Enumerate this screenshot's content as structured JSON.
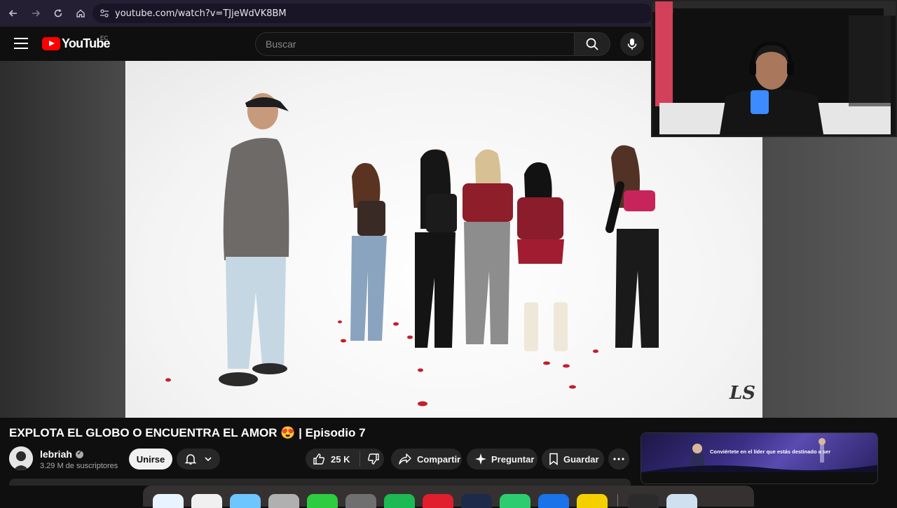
{
  "browser": {
    "url": "youtube.com/watch?v=TJjeWdVK8BM"
  },
  "header": {
    "logo_text": "YouTube",
    "country_code": "EC",
    "search_placeholder": "Buscar"
  },
  "video": {
    "title": "EXPLOTA EL GLOBO O ENCUENTRA EL AMOR 😍 | Episodio 7",
    "watermark": "LS"
  },
  "channel": {
    "name": "lebriah",
    "subscribers": "3.29 M de suscriptores",
    "join_label": "Unirse"
  },
  "actions": {
    "like_count": "25 K",
    "share_label": "Compartir",
    "ask_label": "Preguntar",
    "save_label": "Guardar",
    "more_icon": "more-horizontal-icon"
  },
  "ad": {
    "headline": "Conviértete en el líder que estás destinado a ser"
  },
  "dock": {
    "colors": [
      "#e8f4ff",
      "#f0f0f0",
      "#6ec6ff",
      "#b0b0b0",
      "#2ecc40",
      "#6f6f6f",
      "#1db954",
      "#e01e2d",
      "#1e2a4a",
      "#2ecc71",
      "#1a73e8",
      "#f5d000",
      "#2b2b2b",
      "#cfe0f0"
    ]
  },
  "colors": {
    "accent": "#ff0000",
    "background": "#0f0f0f",
    "pill": "#272727"
  }
}
